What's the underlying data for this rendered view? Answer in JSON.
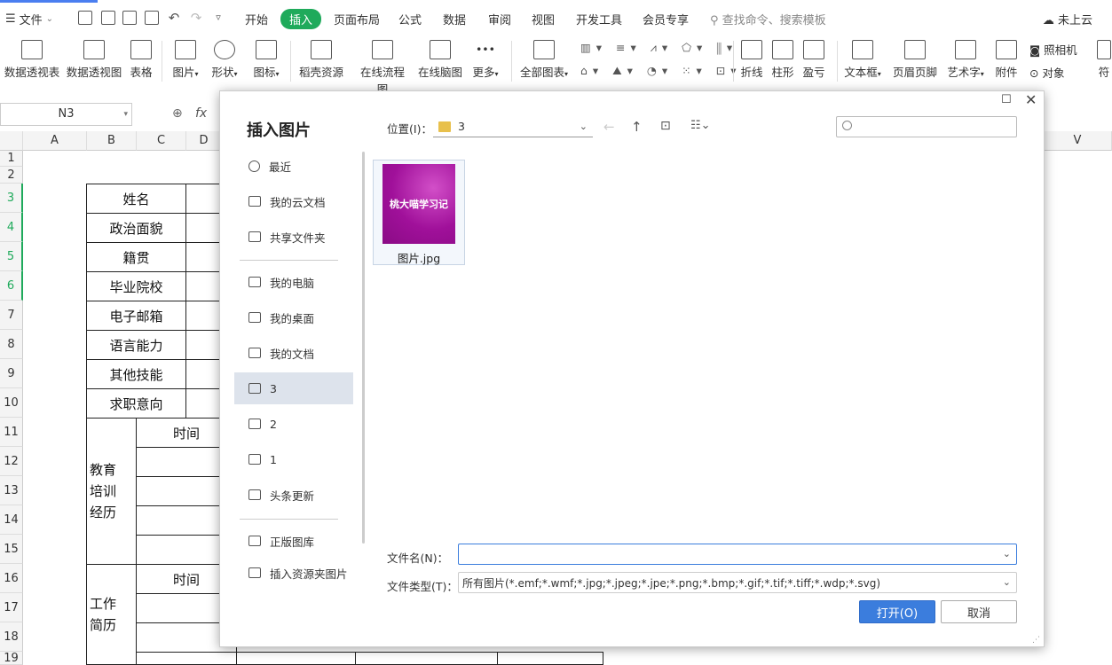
{
  "menubar": {
    "file_label": "文件",
    "tabs": [
      "开始",
      "插入",
      "页面布局",
      "公式",
      "数据",
      "审阅",
      "视图",
      "开发工具",
      "会员专享"
    ],
    "active_tab": "插入",
    "search_placeholder": "查找命令、搜索模板",
    "cloud_label": "未上云"
  },
  "ribbon": {
    "items": [
      "数据透视表",
      "数据透视图",
      "表格",
      "图片",
      "形状",
      "图标",
      "稻壳资源",
      "在线流程图",
      "在线脑图",
      "更多",
      "全部图表",
      "折线",
      "柱形",
      "盈亏",
      "文本框",
      "页眉页脚",
      "艺术字",
      "附件"
    ],
    "small_items": [
      "照相机",
      "对象",
      "符"
    ]
  },
  "formula_bar": {
    "name_box": "N3",
    "fx_label": "fx"
  },
  "sheet": {
    "columns": [
      "A",
      "B",
      "C",
      "D",
      "V"
    ],
    "rows": [
      "1",
      "2",
      "3",
      "4",
      "5",
      "6",
      "7",
      "8",
      "9",
      "10",
      "11",
      "12",
      "13",
      "14",
      "15",
      "16",
      "17",
      "18",
      "19"
    ],
    "labels": [
      "姓名",
      "政治面貌",
      "籍贯",
      "毕业院校",
      "电子邮箱",
      "语言能力",
      "其他技能",
      "求职意向"
    ],
    "time_label": "时间",
    "edu_label": [
      "教育",
      "培训",
      "经历"
    ],
    "work_label": [
      "工作",
      "简历"
    ]
  },
  "dialog": {
    "title": "插入图片",
    "location_label": "位置(I)：",
    "location_value": "3",
    "nav": [
      "最近",
      "我的云文档",
      "共享文件夹",
      "我的电脑",
      "我的桌面",
      "我的文档",
      "3",
      "2",
      "1",
      "头条更新",
      "正版图库",
      "插入资源夹图片"
    ],
    "selected_nav": "3",
    "file": {
      "thumb_text": "桃大喵学习记",
      "name": "图片.jpg"
    },
    "filename_label": "文件名(N)：",
    "filename_value": "",
    "filetype_label": "文件类型(T)：",
    "filetype_value": "所有图片(*.emf;*.wmf;*.jpg;*.jpeg;*.jpe;*.png;*.bmp;*.gif;*.tif;*.tiff;*.wdp;*.svg)",
    "open_button": "打开(O)",
    "cancel_button": "取消"
  }
}
